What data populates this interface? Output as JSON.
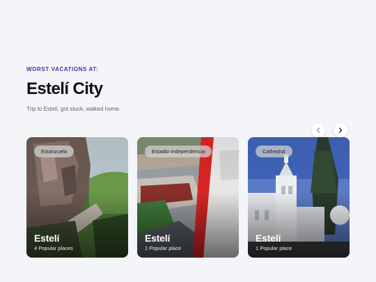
{
  "header": {
    "eyebrow": "WORST VACATIONS AT:",
    "title": "Estelí City",
    "subtitle": "Trip to Estelí, got stuck, walked home."
  },
  "carousel": {
    "prev_icon": "chevron-left-icon",
    "next_icon": "chevron-right-icon",
    "cards": [
      {
        "tag": "Estanzuela",
        "title": "Estelí",
        "subtitle": "4 Popular places"
      },
      {
        "tag": "Estadio Independencia",
        "title": "Estelí",
        "subtitle": "1 Popular place"
      },
      {
        "tag": "Cathedral",
        "title": "Estelí",
        "subtitle": "1 Popular place"
      }
    ]
  },
  "colors": {
    "page_background": "#f4f5f8",
    "eyebrow_accent": "#4b2ea1",
    "prev_arrow": "#8a8fb5",
    "next_arrow": "#1a1a2e"
  }
}
